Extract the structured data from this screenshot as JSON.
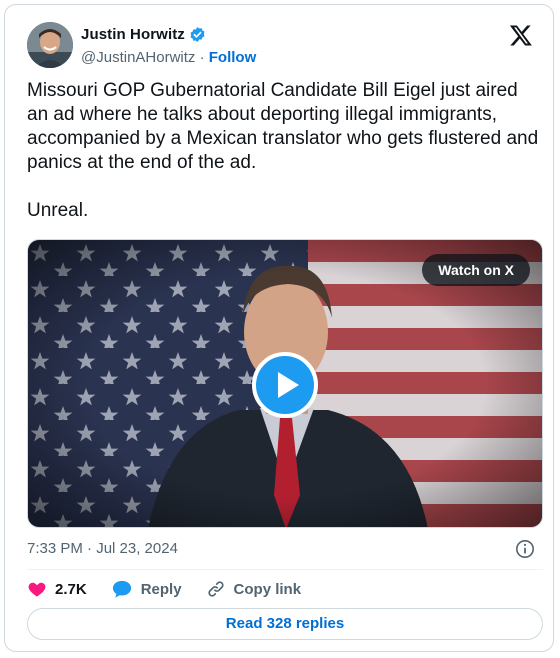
{
  "author": {
    "name": "Justin Horwitz",
    "handle": "@JustinAHorwitz",
    "separator": "·",
    "follow_label": "Follow"
  },
  "tweet": {
    "paragraphs": [
      "Missouri GOP Gubernatorial Candidate Bill Eigel just aired an ad where he talks about deporting illegal immigrants, accompanied by a Mexican translator who gets flustered and panics at the end of the ad.",
      "Unreal."
    ],
    "timestamp": "7:33 PM · Jul 23, 2024"
  },
  "media": {
    "watch_label": "Watch on X"
  },
  "actions": {
    "likes": "2.7K",
    "reply_label": "Reply",
    "copy_label": "Copy link"
  },
  "replies_button": "Read 328 replies",
  "colors": {
    "accent": "#1d9bf0",
    "like": "#f91880",
    "link": "#006fd6",
    "muted": "#536471"
  }
}
